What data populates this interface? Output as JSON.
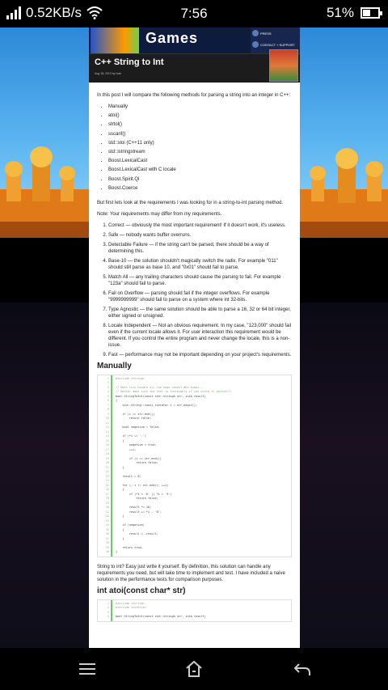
{
  "status": {
    "speed": "0.52KB/s",
    "time": "7:56",
    "battery": "51%",
    "battery_level": 0.51
  },
  "site": {
    "brand": "Games",
    "nav": [
      "PRESS",
      "CONTACT + SUPPORT"
    ]
  },
  "article": {
    "title": "C++ String to Int",
    "meta": "Aug 18, 2013 by Ivan",
    "intro": "In this post I will compare the following methods for parsing a string into an integer in C++:",
    "methods": [
      "Manually",
      "atoi()",
      "strtol()",
      "sscanf()",
      "std::stoi (C++11 only)",
      "std::istringstream",
      "Boost.LexicalCast",
      "Boost.LexicalCast with C locale",
      "Boost.Spirit.Qi",
      "Boost.Coerce"
    ],
    "req_intro": "But first lets look at the requirements I was looking for in a string-to-int parsing method.",
    "note": "Note: Your requirements may differ from my requirements.",
    "requirements": [
      "Correct — obviously the most important requirement! If it doesn't work, it's useless.",
      "Safe — nobody wants buffer overruns.",
      "Detectable Failure — if the string can't be parsed, there should be a way of determining this.",
      "Base-10 — the solution shouldn't magically switch the radix. For example \"011\" should still parse as base 10, and \"0x01\" should fail to parse.",
      "Match All — any trailing characters should cause the parsing to fail. For example \"123a\" should fail to parse.",
      "Fail on Overflow — parsing should fail if the integer overflows. For example \"9999999999\" should fail to parse on a system where int 32-bits.",
      "Type Agnostic — the same solution should be able to parse a 16, 32 or 64 bit integer, either signed or unsigned.",
      "Locale Independent — Not an obvious requirement. In my case, \"123,000\" should fail even if the current locale allows it. For user interaction this requirement would be different. If you control the entire program and never change the locale, this is a non-issue.",
      "Fast — performance may not be important depending on your project's requirements."
    ],
    "section1": "Manually",
    "code1": [
      "#include <string>",
      "",
      "// Does this handle all the edge cases? Who knows...",
      "// Better make sure the test is thoroughly if you write it yourself!",
      "bool StringToInt(const std::string& str, int& result)",
      "{",
      "    std::string::const_iterator i = str.begin();",
      "",
      "    if (i == str.end())",
      "        return false;",
      "",
      "    bool negative = false;",
      "",
      "    if (*i == '-')",
      "    {",
      "        negative = true;",
      "        ++i;",
      "",
      "        if (i == str.end())",
      "            return false;",
      "    }",
      "",
      "    result = 0;",
      "",
      "    for (; i != str.end(); ++i)",
      "    {",
      "        if (*i < '0' || *i > '9')",
      "            return false;",
      "",
      "        result *= 10;",
      "        result += *i - '0';",
      "    }",
      "",
      "    if (negative)",
      "    {",
      "        result = -result;",
      "    }",
      "",
      "    return true;",
      "}"
    ],
    "after_code": "String to int? Easy just write it yourself. By definition, this solution can handle any requirements you need, but will take time to implement and test. I have included a naive solution in the performance tests for comparison purposes.",
    "section2": "int atoi(const char* str)",
    "code2": [
      "#include <string>",
      "#include <cstdlib>",
      "",
      "bool StringToInt(const std::string& str, int& result)"
    ]
  }
}
